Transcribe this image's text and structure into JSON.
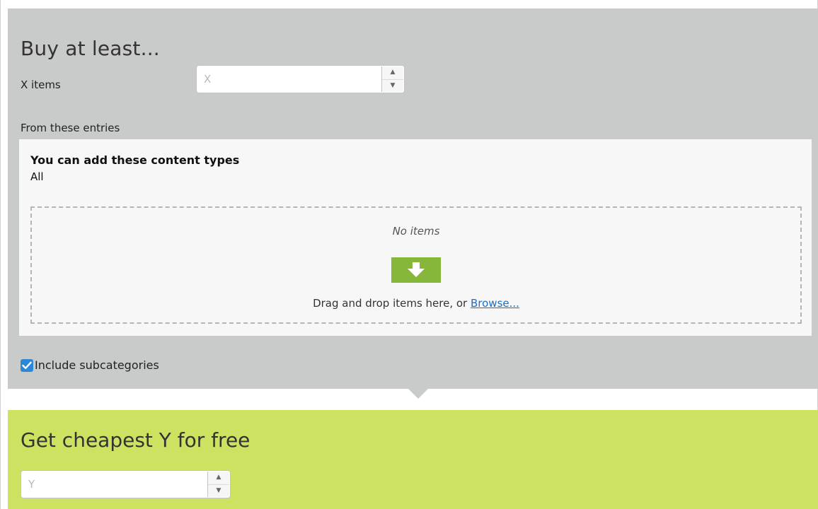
{
  "buy_section": {
    "title": "Buy at least...",
    "x_label": "X items",
    "x_placeholder": "X",
    "x_value": ""
  },
  "entries": {
    "label": "From these entries",
    "content_types_title": "You can add these content types",
    "content_types_value": "All",
    "empty_text": "No items",
    "drop_text": "Drag and drop items here, or ",
    "browse_link": "Browse...",
    "drop_icon": "arrow-down-icon"
  },
  "include_subcategories": {
    "label": "Include subcategories",
    "checked": true
  },
  "free_section": {
    "title": "Get cheapest Y for free",
    "y_placeholder": "Y",
    "y_value": ""
  },
  "colors": {
    "buy_panel_bg": "#c9caca",
    "free_panel_bg": "#cde260",
    "drop_icon_bg": "#86b63a",
    "checkbox_bg": "#2b88d8",
    "link": "#1a6fc4"
  }
}
